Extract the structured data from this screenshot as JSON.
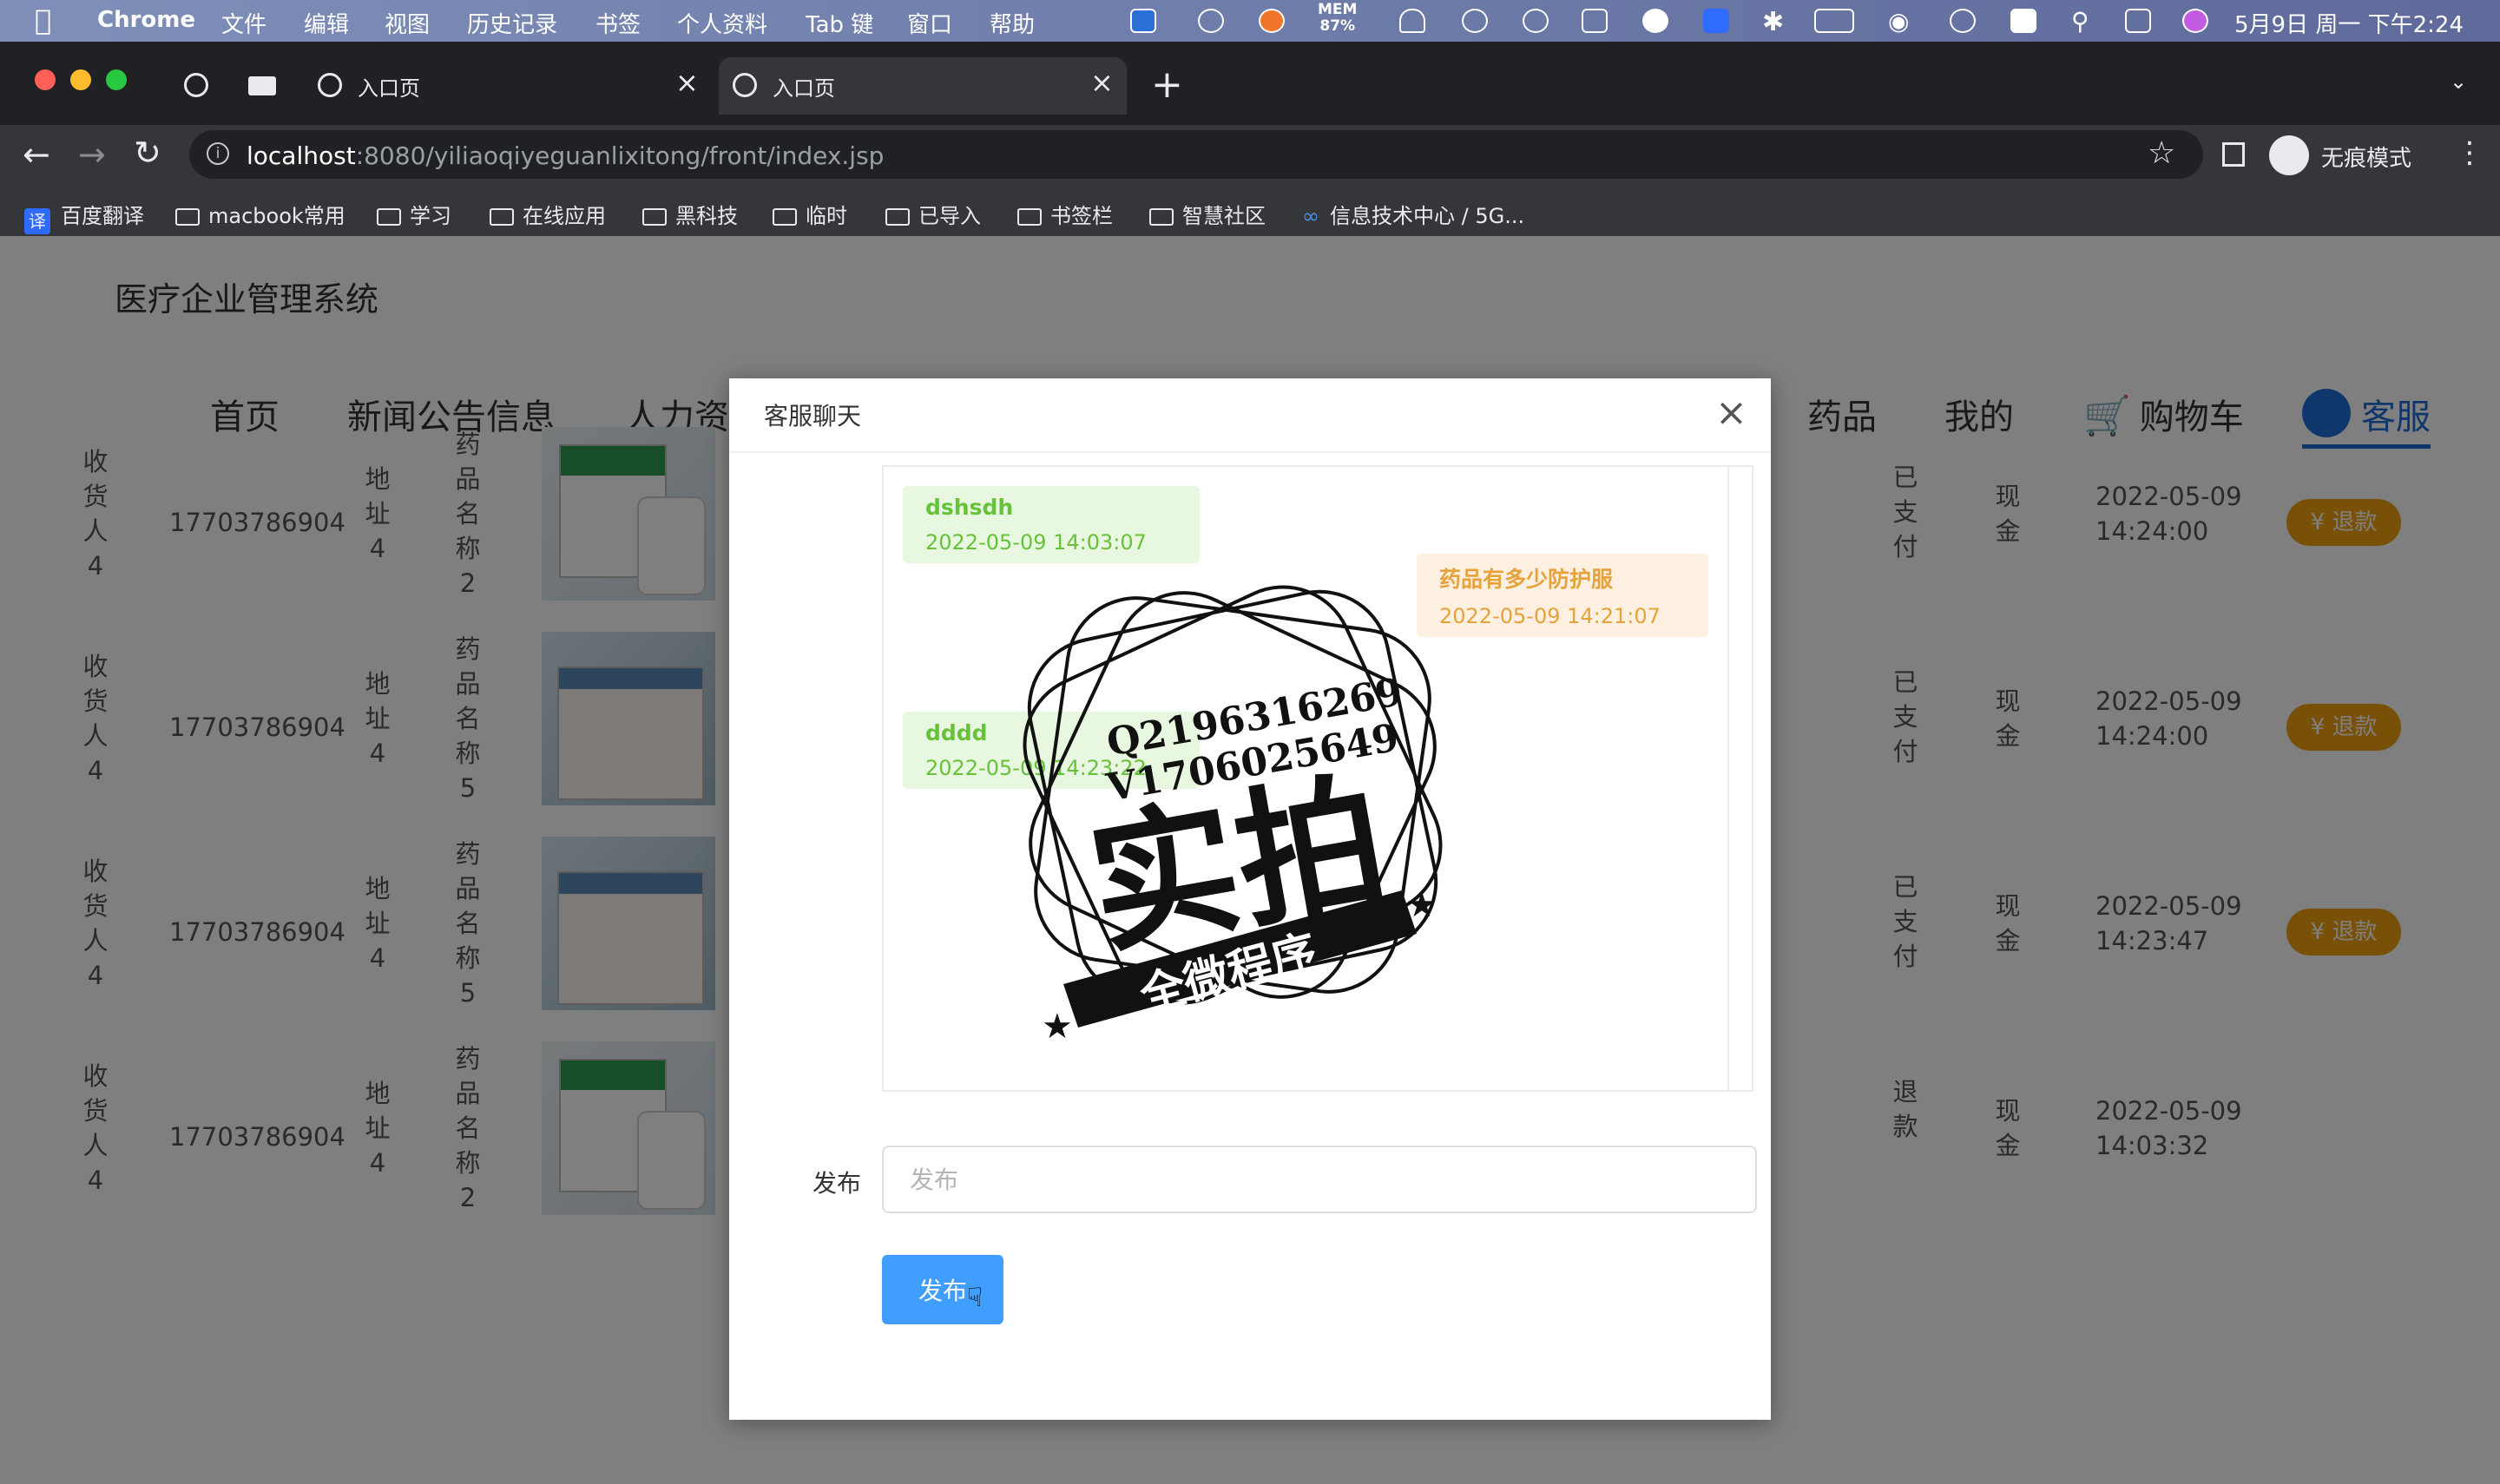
{
  "menubar": {
    "app_name": "Chrome",
    "menus": [
      "文件",
      "编辑",
      "视图",
      "历史记录",
      "书签",
      "个人资料",
      "Tab 键",
      "窗口",
      "帮助"
    ],
    "mem_label": "MEM",
    "mem_value": "87%",
    "clock": "5月9日 周一 下午2:24"
  },
  "browser": {
    "tabs": [
      {
        "title": ""
      },
      {
        "title": ""
      },
      {
        "title": "入口页"
      },
      {
        "title": "入口页"
      }
    ],
    "address": {
      "host": "localhost",
      "path": ":8080/yiliaoqiyeguanlixitong/front/index.jsp"
    },
    "profile_label": "无痕模式",
    "bookmarks": [
      "百度翻译",
      "macbook常用",
      "学习",
      "在线应用",
      "黑科技",
      "临时",
      "已导入",
      "书签栏",
      "智慧社区",
      "信息技术中心 / 5G..."
    ],
    "translate_badge": "译"
  },
  "site": {
    "title": "医疗企业管理系统",
    "nav": [
      "首页",
      "新闻公告信息",
      "人力资",
      "药品",
      "我的",
      "购物车",
      "客服"
    ]
  },
  "orders": [
    {
      "receiver": "收货人4",
      "phone": "17703786904",
      "address": "地址4",
      "product": "药品名称2",
      "pay_status": "已支付",
      "pay_type": "现金",
      "date": "2022-05-09",
      "time": "14:24:00",
      "action": "退款",
      "img": "box"
    },
    {
      "receiver": "收货人4",
      "phone": "17703786904",
      "address": "地址4",
      "product": "药品名称5",
      "pay_status": "已支付",
      "pay_type": "现金",
      "date": "2022-05-09",
      "time": "14:24:00",
      "action": "退款",
      "img": "alt"
    },
    {
      "receiver": "收货人4",
      "phone": "17703786904",
      "address": "地址4",
      "product": "药品名称5",
      "pay_status": "已支付",
      "pay_type": "现金",
      "date": "2022-05-09",
      "time": "14:23:47",
      "action": "退款",
      "img": "alt"
    },
    {
      "receiver": "收货人4",
      "phone": "17703786904",
      "address": "地址4",
      "product": "药品名称2",
      "pay_status": "退款",
      "pay_type": "现金",
      "date": "2022-05-09",
      "time": "14:03:32",
      "action": "",
      "img": "box"
    }
  ],
  "dialog": {
    "title": "客服聊天",
    "messages": [
      {
        "side": "left",
        "text": "dshsdh",
        "time": "2022-05-09 14:03:07"
      },
      {
        "side": "right",
        "text": "药品有多少防护服",
        "time": "2022-05-09 14:21:07"
      },
      {
        "side": "left",
        "text": "dddd",
        "time": "2022-05-09 14:23:22"
      }
    ],
    "form_label": "发布",
    "input_placeholder": "发布",
    "input_value": "",
    "submit_label": "发布"
  },
  "watermark": {
    "line1": "Q2196316269",
    "line2": "V1706025649",
    "big": "实拍",
    "ribbon": "全微程序"
  },
  "colors": {
    "menubar": "#6b79a7",
    "chrome_dark": "#202124",
    "chrome_toolbar": "#35363a",
    "primary": "#409eff",
    "refund": "#f2a10f",
    "active_nav": "#1e6fd9",
    "chat_left": "#67c23a",
    "chat_right": "#e6a23c"
  }
}
